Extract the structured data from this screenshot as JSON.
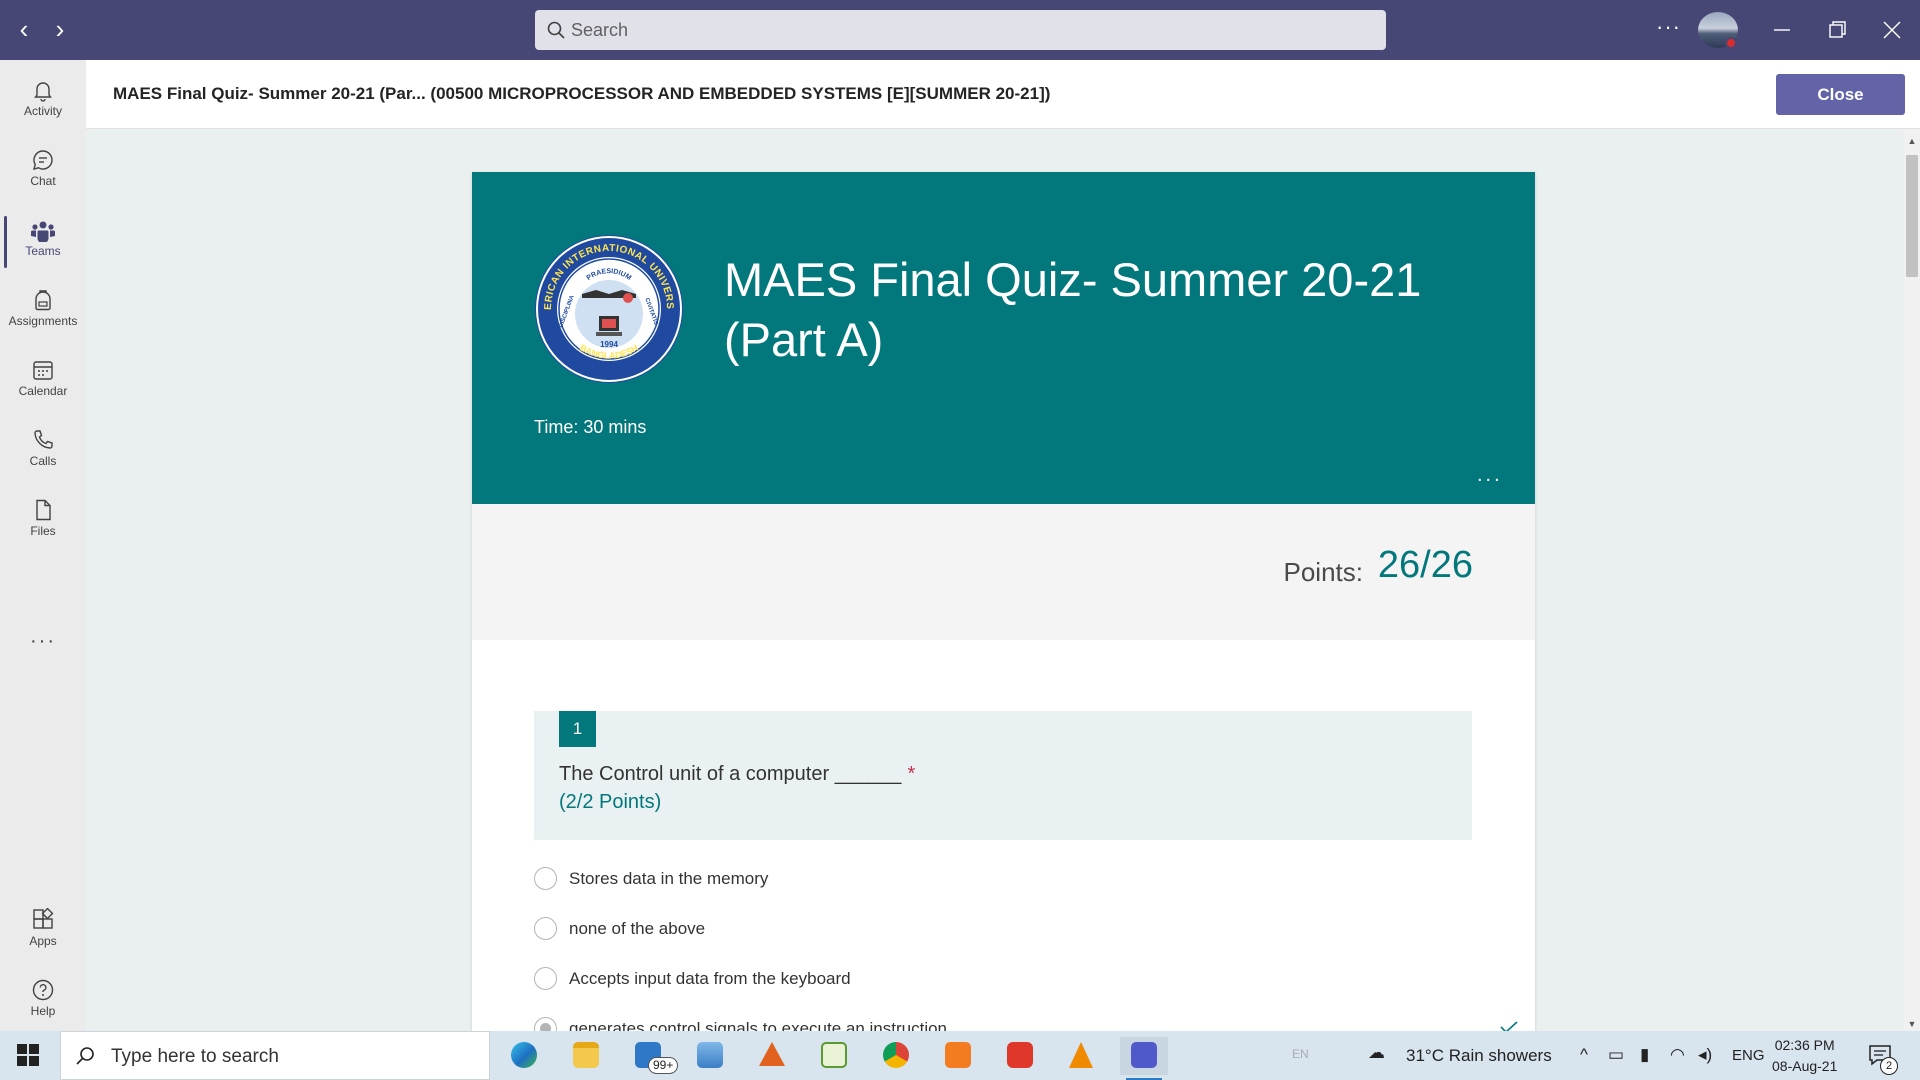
{
  "titlebar": {
    "search_placeholder": "Search",
    "more_label": "···"
  },
  "rail": {
    "items": [
      {
        "label": "Activity"
      },
      {
        "label": "Chat"
      },
      {
        "label": "Teams"
      },
      {
        "label": "Assignments"
      },
      {
        "label": "Calendar"
      },
      {
        "label": "Calls"
      },
      {
        "label": "Files"
      }
    ],
    "more": "···",
    "bottom": [
      {
        "label": "Apps"
      },
      {
        "label": "Help"
      }
    ]
  },
  "header": {
    "title": "MAES Final Quiz- Summer 20-21  (Par... (00500 MICROPROCESSOR AND EMBEDDED SYSTEMS [E][SUMMER 20-21])",
    "close_label": "Close"
  },
  "quiz": {
    "title": "MAES Final Quiz- Summer 20-21 (Part A)",
    "description": "Time: 30 mins",
    "more": "...",
    "points_label": "Points:",
    "points_value": "26/26",
    "logo_text": {
      "top": "AMERICAN INTERNATIONAL UNIVERSITY",
      "motto": "PRAESIDIUM",
      "left": "DISCIPLINA",
      "right": "CIVITATIS",
      "year": "1994",
      "bottom": "BANGLADESH"
    },
    "question": {
      "number": "1",
      "text": "The Control unit of a computer ______",
      "required": "*",
      "points": "(2/2 Points)",
      "options": [
        "Stores data in the memory",
        "none of the above",
        "Accepts input data from the keyboard",
        "generates control signals to execute an instruction"
      ]
    }
  },
  "taskbar": {
    "search_placeholder": "Type here to search",
    "mail_badge": "99+",
    "lang_indicator": "EN",
    "weather": "31°C  Rain showers",
    "lang": "ENG",
    "time": "02:36 PM",
    "date": "08-Aug-21",
    "notifications": "2"
  },
  "colors": {
    "titlebar": "#464775",
    "accent": "#6264a7",
    "teal": "#03787c"
  }
}
